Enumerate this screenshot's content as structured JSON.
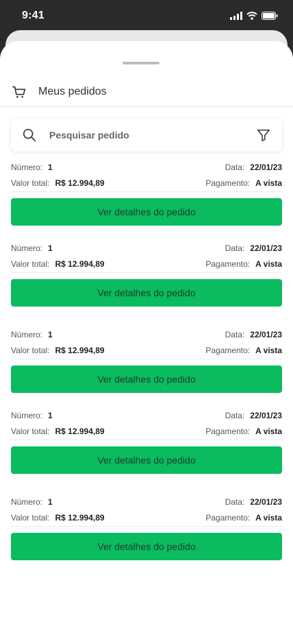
{
  "status_bar": {
    "time": "9:41"
  },
  "header": {
    "title": "Meus pedidos"
  },
  "search": {
    "placeholder": "Pesquisar pedido"
  },
  "labels": {
    "number": "Número:",
    "date": "Data:",
    "total": "Valor total:",
    "payment": "Pagamento:",
    "details_button": "Ver detalhes do pedido"
  },
  "orders": [
    {
      "number": "1",
      "date": "22/01/23",
      "total": "R$ 12.994,89",
      "payment": "A vista"
    },
    {
      "number": "1",
      "date": "22/01/23",
      "total": "R$ 12.994,89",
      "payment": "A vista"
    },
    {
      "number": "1",
      "date": "22/01/23",
      "total": "R$ 12.994,89",
      "payment": "A vista"
    },
    {
      "number": "1",
      "date": "22/01/23",
      "total": "R$ 12.994,89",
      "payment": "A vista"
    },
    {
      "number": "1",
      "date": "22/01/23",
      "total": "R$ 12.994,89",
      "payment": "A vista"
    }
  ],
  "colors": {
    "accent": "#0abb5f",
    "background": "#2b2b2b"
  }
}
